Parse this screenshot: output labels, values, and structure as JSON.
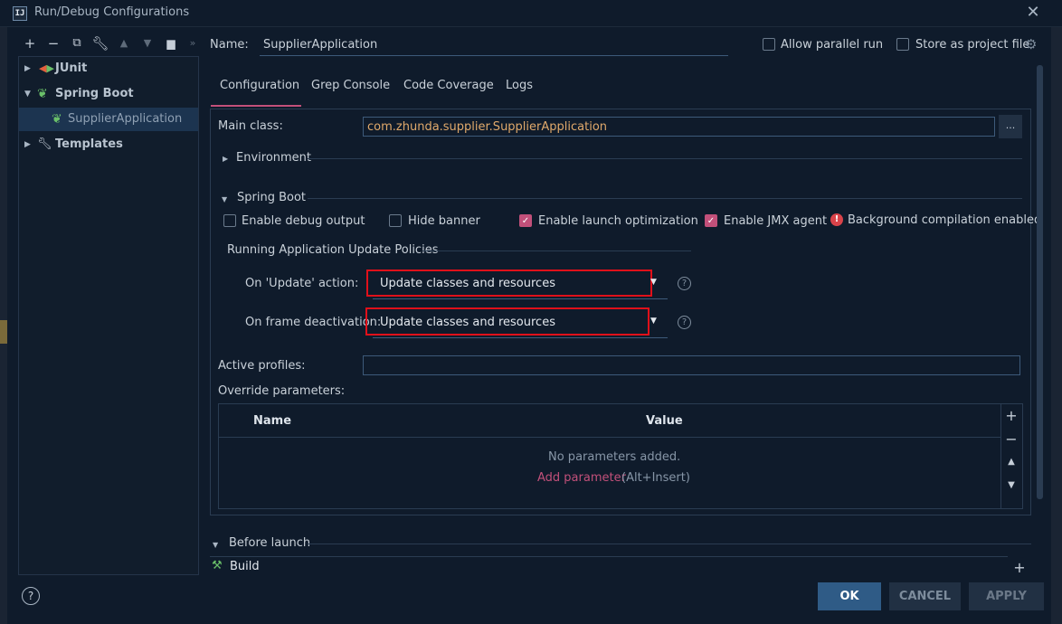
{
  "window": {
    "title": "Run/Debug Configurations",
    "logo": "IJ"
  },
  "toolbar": {
    "icons": [
      "add-icon",
      "remove-icon",
      "copy-icon",
      "wrench-icon",
      "move-up-icon",
      "move-down-icon",
      "folder-icon",
      "more-icon"
    ]
  },
  "tree": {
    "items": [
      {
        "label": "JUnit",
        "expanded": false
      },
      {
        "label": "Spring Boot",
        "expanded": true
      },
      {
        "label": "SupplierApplication",
        "selected": true
      },
      {
        "label": "Templates",
        "expanded": false
      }
    ]
  },
  "name": {
    "label": "Name:",
    "value": "SupplierApplication"
  },
  "options": {
    "allow_parallel_run": "Allow parallel run",
    "store_as_project_file": "Store as project file"
  },
  "tabs": [
    "Configuration",
    "Grep Console",
    "Code Coverage",
    "Logs"
  ],
  "config": {
    "main_class_label": "Main class:",
    "main_class_value": "com.zhunda.supplier.SupplierApplication",
    "browse_label": "...",
    "environment_label": "Environment",
    "spring_boot_label": "Spring Boot",
    "checkboxes": {
      "debug_output": "Enable debug output",
      "hide_banner": "Hide banner",
      "launch_optimization": "Enable launch optimization",
      "jmx_agent": "Enable JMX agent"
    },
    "warning": "Background compilation enabled",
    "policies_title": "Running Application Update Policies",
    "update_action_label": "On 'Update' action:",
    "update_action_value": "Update classes and resources",
    "frame_deactivation_label": "On frame deactivation:",
    "frame_deactivation_value": "Update classes and resources",
    "help": "?",
    "active_profiles_label": "Active profiles:",
    "active_profiles_value": "",
    "override_label": "Override parameters:",
    "table": {
      "col_name": "Name",
      "col_value": "Value",
      "empty_text": "No parameters added.",
      "add_link": "Add parameter",
      "add_shortcut": "(Alt+Insert)"
    }
  },
  "before_launch": {
    "label": "Before launch",
    "task": "Build"
  },
  "buttons": {
    "ok": "OK",
    "cancel": "CANCEL",
    "apply": "APPLY",
    "help": "?"
  },
  "colors": {
    "accent": "#c2507a",
    "primary_button": "#2f5b86",
    "highlight_box": "#e0101a",
    "link": "#c2507a"
  }
}
